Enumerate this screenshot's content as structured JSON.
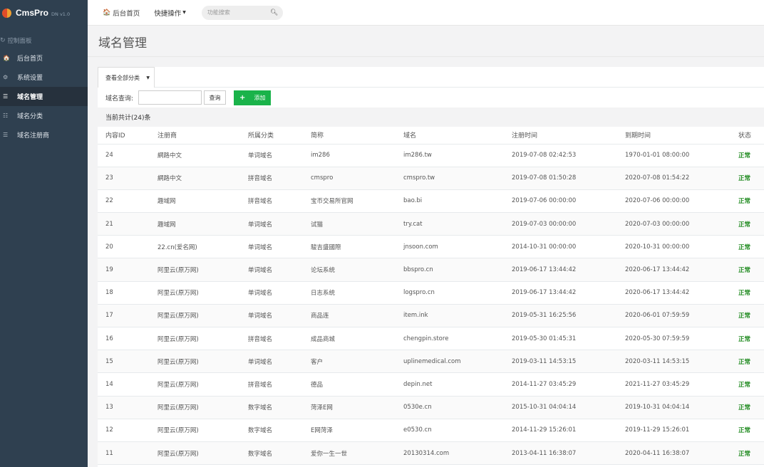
{
  "brand": {
    "name": "CmsPro",
    "version": "DN v1.0"
  },
  "sidebar": {
    "section_label": "控制面板",
    "items": [
      {
        "label": "后台首页",
        "icon": "home-icon",
        "glyph": "🏠",
        "active": false
      },
      {
        "label": "系统设置",
        "icon": "gear-icon",
        "glyph": "⚙",
        "active": false
      },
      {
        "label": "域名管理",
        "icon": "list-icon",
        "glyph": "☰",
        "active": true
      },
      {
        "label": "域名分类",
        "icon": "sliders-icon",
        "glyph": "☷",
        "active": false
      },
      {
        "label": "域名注册商",
        "icon": "list-icon",
        "glyph": "☰",
        "active": false
      }
    ]
  },
  "topbar": {
    "home_label": "后台首页",
    "quick_label": "快捷操作",
    "search_placeholder": "功能搜索"
  },
  "page": {
    "title": "域名管理"
  },
  "filter": {
    "category_selected": "查看全部分类",
    "query_label": "域名查询:",
    "query_value": "",
    "query_button": "查询",
    "add_button": "添加",
    "count_text": "当前共计(24)条"
  },
  "table": {
    "columns": [
      "内容ID",
      "注册商",
      "所属分类",
      "简称",
      "域名",
      "注册时间",
      "到期时间",
      "状态"
    ],
    "rows": [
      [
        "24",
        "網路中文",
        "单词域名",
        "im286",
        "im286.tw",
        "2019-07-08 02:42:53",
        "1970-01-01 08:00:00",
        "正常"
      ],
      [
        "23",
        "網路中文",
        "拼音域名",
        "cmspro",
        "cmspro.tw",
        "2019-07-08 01:50:28",
        "2020-07-08 01:54:22",
        "正常"
      ],
      [
        "22",
        "趣域网",
        "拼音域名",
        "宝币交易所官网",
        "bao.bi",
        "2019-07-06 00:00:00",
        "2020-07-06 00:00:00",
        "正常"
      ],
      [
        "21",
        "趣域网",
        "单词域名",
        "试猫",
        "try.cat",
        "2019-07-03 00:00:00",
        "2020-07-03 00:00:00",
        "正常"
      ],
      [
        "20",
        "22.cn(爱名网)",
        "单词域名",
        "駿吉盛國際",
        "jnsoon.com",
        "2014-10-31 00:00:00",
        "2020-10-31 00:00:00",
        "正常"
      ],
      [
        "19",
        "阿里云(原万网)",
        "单词域名",
        "论坛系统",
        "bbspro.cn",
        "2019-06-17 13:44:42",
        "2020-06-17 13:44:42",
        "正常"
      ],
      [
        "18",
        "阿里云(原万网)",
        "单词域名",
        "日志系统",
        "logspro.cn",
        "2019-06-17 13:44:42",
        "2020-06-17 13:44:42",
        "正常"
      ],
      [
        "17",
        "阿里云(原万网)",
        "单词域名",
        "商品连",
        "item.ink",
        "2019-05-31 16:25:56",
        "2020-06-01 07:59:59",
        "正常"
      ],
      [
        "16",
        "阿里云(原万网)",
        "拼音域名",
        "成品商城",
        "chengpin.store",
        "2019-05-30 01:45:31",
        "2020-05-30 07:59:59",
        "正常"
      ],
      [
        "15",
        "阿里云(原万网)",
        "单词域名",
        "客户",
        "uplinemedical.com",
        "2019-03-11 14:53:15",
        "2020-03-11 14:53:15",
        "正常"
      ],
      [
        "14",
        "阿里云(原万网)",
        "拼音域名",
        "德品",
        "depin.net",
        "2014-11-27 03:45:29",
        "2021-11-27 03:45:29",
        "正常"
      ],
      [
        "13",
        "阿里云(原万网)",
        "数字域名",
        "菏泽E网",
        "0530e.cn",
        "2015-10-31 04:04:14",
        "2019-10-31 04:04:14",
        "正常"
      ],
      [
        "12",
        "阿里云(原万网)",
        "数字域名",
        "E网菏泽",
        "e0530.cn",
        "2014-11-29 15:26:01",
        "2019-11-29 15:26:01",
        "正常"
      ],
      [
        "11",
        "阿里云(原万网)",
        "数字域名",
        "爱你一生一世",
        "20130314.com",
        "2013-04-11 16:38:07",
        "2020-04-11 16:38:07",
        "正常"
      ]
    ]
  }
}
